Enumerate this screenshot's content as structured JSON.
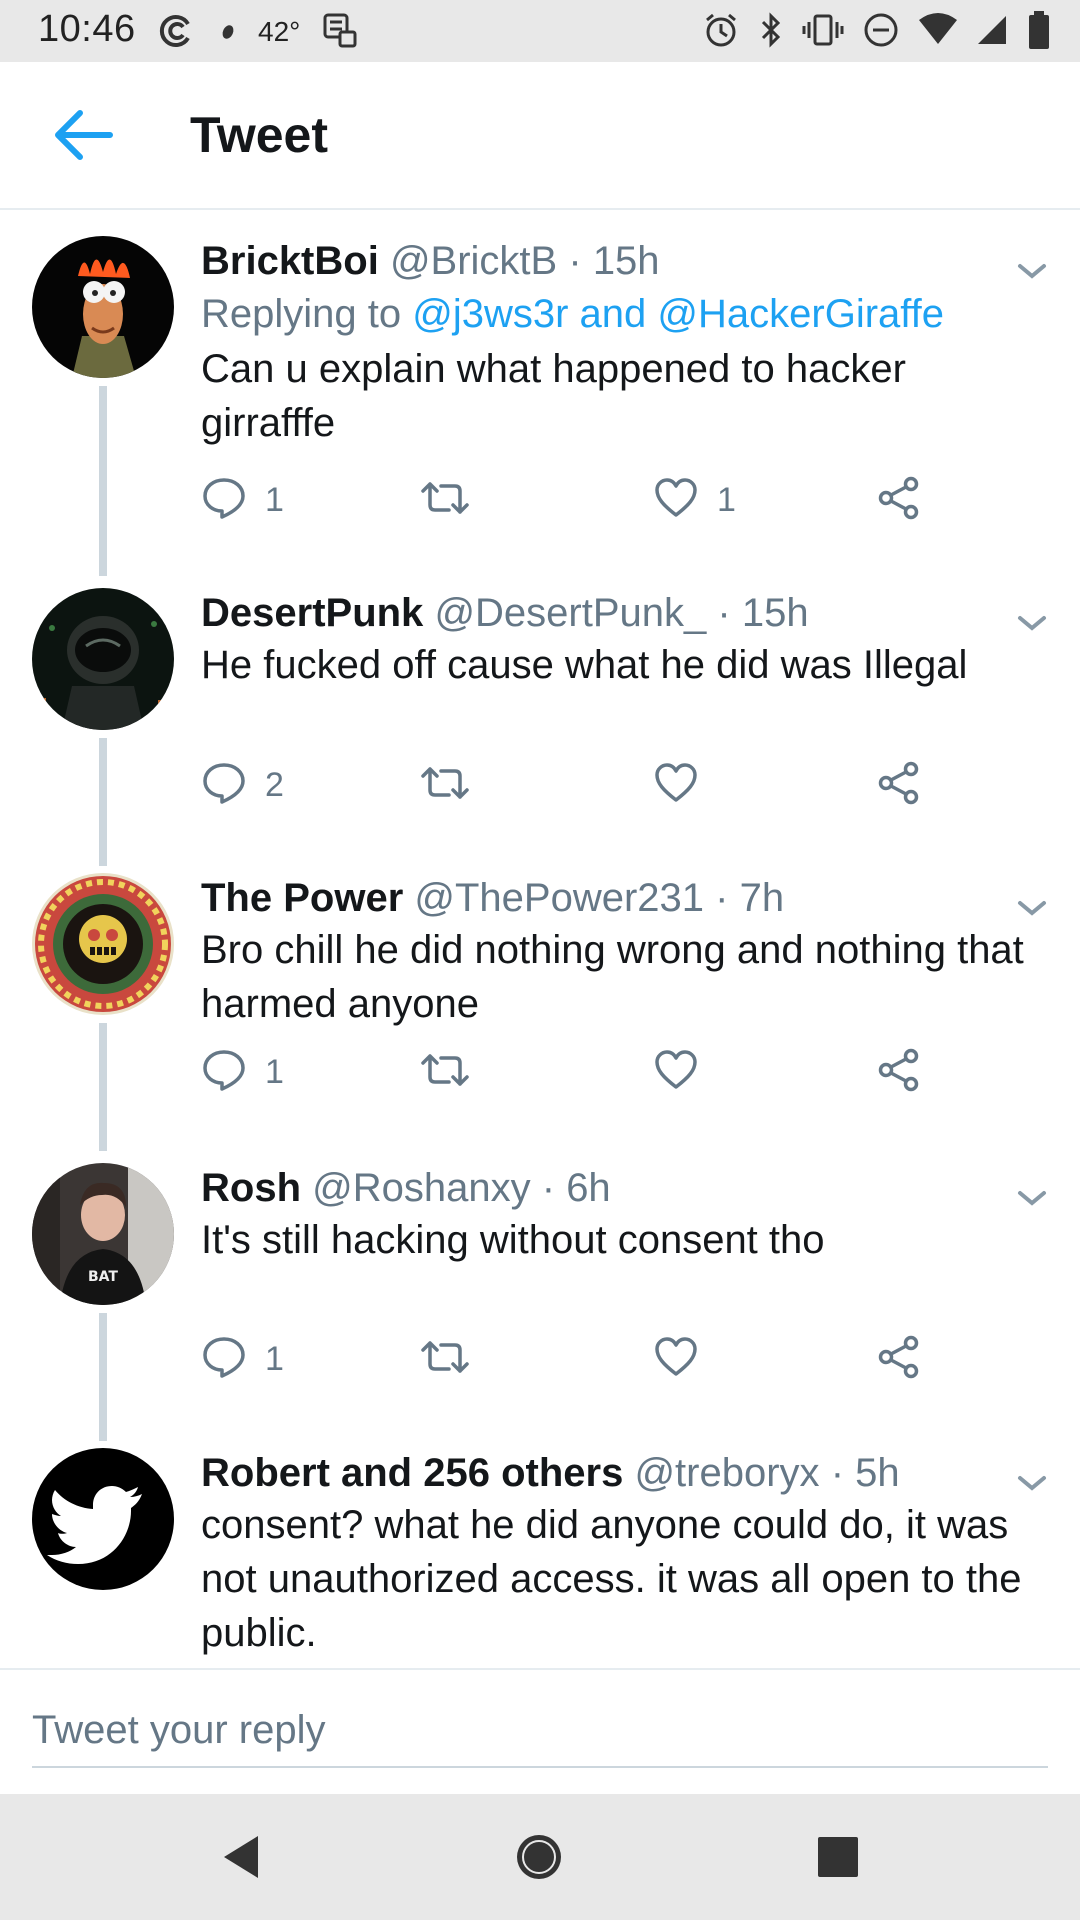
{
  "status_bar": {
    "time": "10:46",
    "temperature": "42°"
  },
  "header": {
    "title": "Tweet"
  },
  "tweets": [
    {
      "name": "BricktBoi",
      "handle": "@BricktB",
      "time": "15h",
      "replying_prefix": "Replying to",
      "replying_mentions": "@j3ws3r and @HackerGiraffe",
      "text": "Can u explain what happened to hacker girrafffe",
      "reply_count": "1",
      "retweet_count": "",
      "like_count": "1"
    },
    {
      "name": "DesertPunk",
      "handle": "@DesertPunk_",
      "time": "15h",
      "text": "He fucked off cause what he did was Illegal",
      "reply_count": "2",
      "retweet_count": "",
      "like_count": ""
    },
    {
      "name": "The Power",
      "handle": "@ThePower231",
      "time": "7h",
      "text": "Bro chill he did nothing wrong and nothing that harmed anyone",
      "reply_count": "1",
      "retweet_count": "",
      "like_count": ""
    },
    {
      "name": "Rosh",
      "handle": "@Roshanxy",
      "time": "6h",
      "text": "It's still hacking without consent tho",
      "reply_count": "1",
      "retweet_count": "",
      "like_count": ""
    },
    {
      "name": "Robert and 256 others",
      "handle": "@treboryx",
      "time": "5h",
      "text": "consent? what he did anyone could do, it was not unauthorized access. it was all open to the public."
    }
  ],
  "separator": "·",
  "reply_composer": {
    "placeholder": "Tweet your reply"
  },
  "colors": {
    "accent": "#1da1f2",
    "secondary_text": "#657786",
    "thread_line": "#ccd6dd",
    "system_bar": "#e8e8e8"
  },
  "icons": {
    "back": "arrow-left-icon",
    "reply": "comment-icon",
    "retweet": "retweet-icon",
    "like": "heart-icon",
    "share": "share-icon",
    "caret": "chevron-down-icon"
  }
}
